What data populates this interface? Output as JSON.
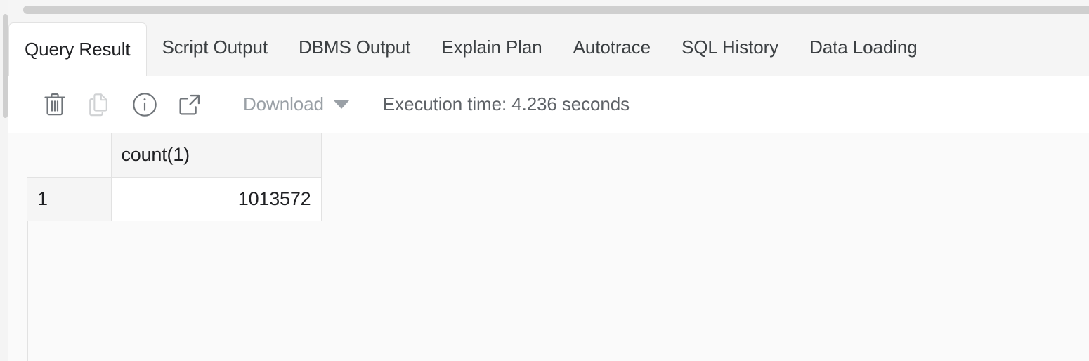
{
  "scrollbars": {
    "horizontal_name": "horizontal-scrollbar",
    "vertical_name": "vertical-scrollbar"
  },
  "tabs": [
    {
      "label": "Query Result",
      "active": true
    },
    {
      "label": "Script Output",
      "active": false
    },
    {
      "label": "DBMS Output",
      "active": false
    },
    {
      "label": "Explain Plan",
      "active": false
    },
    {
      "label": "Autotrace",
      "active": false
    },
    {
      "label": "SQL History",
      "active": false
    },
    {
      "label": "Data Loading",
      "active": false
    }
  ],
  "toolbar": {
    "icons": [
      {
        "name": "trash-icon",
        "title": "Clear",
        "enabled": true
      },
      {
        "name": "copy-icon",
        "title": "Copy",
        "enabled": false
      },
      {
        "name": "info-icon",
        "title": "Info",
        "enabled": true
      },
      {
        "name": "external-link-icon",
        "title": "Open in new window",
        "enabled": true
      }
    ],
    "download_label": "Download",
    "download_caret": "chevron-down-icon",
    "execution_time": "Execution time: 4.236 seconds"
  },
  "grid": {
    "columns": [
      "count(1)"
    ],
    "rows": [
      {
        "num": "1",
        "values": [
          "1013572"
        ]
      }
    ]
  },
  "colors": {
    "tabbar_bg": "#f5f5f5",
    "active_tab_bg": "#ffffff",
    "toolbar_bg": "#ffffff",
    "grid_bg": "#fafafa",
    "header_bg": "#f5f5f5",
    "cell_bg": "#ffffff",
    "border": "#e2e2e2",
    "text": "#202124",
    "muted_text": "#9aa0a6",
    "scroll_thumb": "#cfcfcf"
  }
}
